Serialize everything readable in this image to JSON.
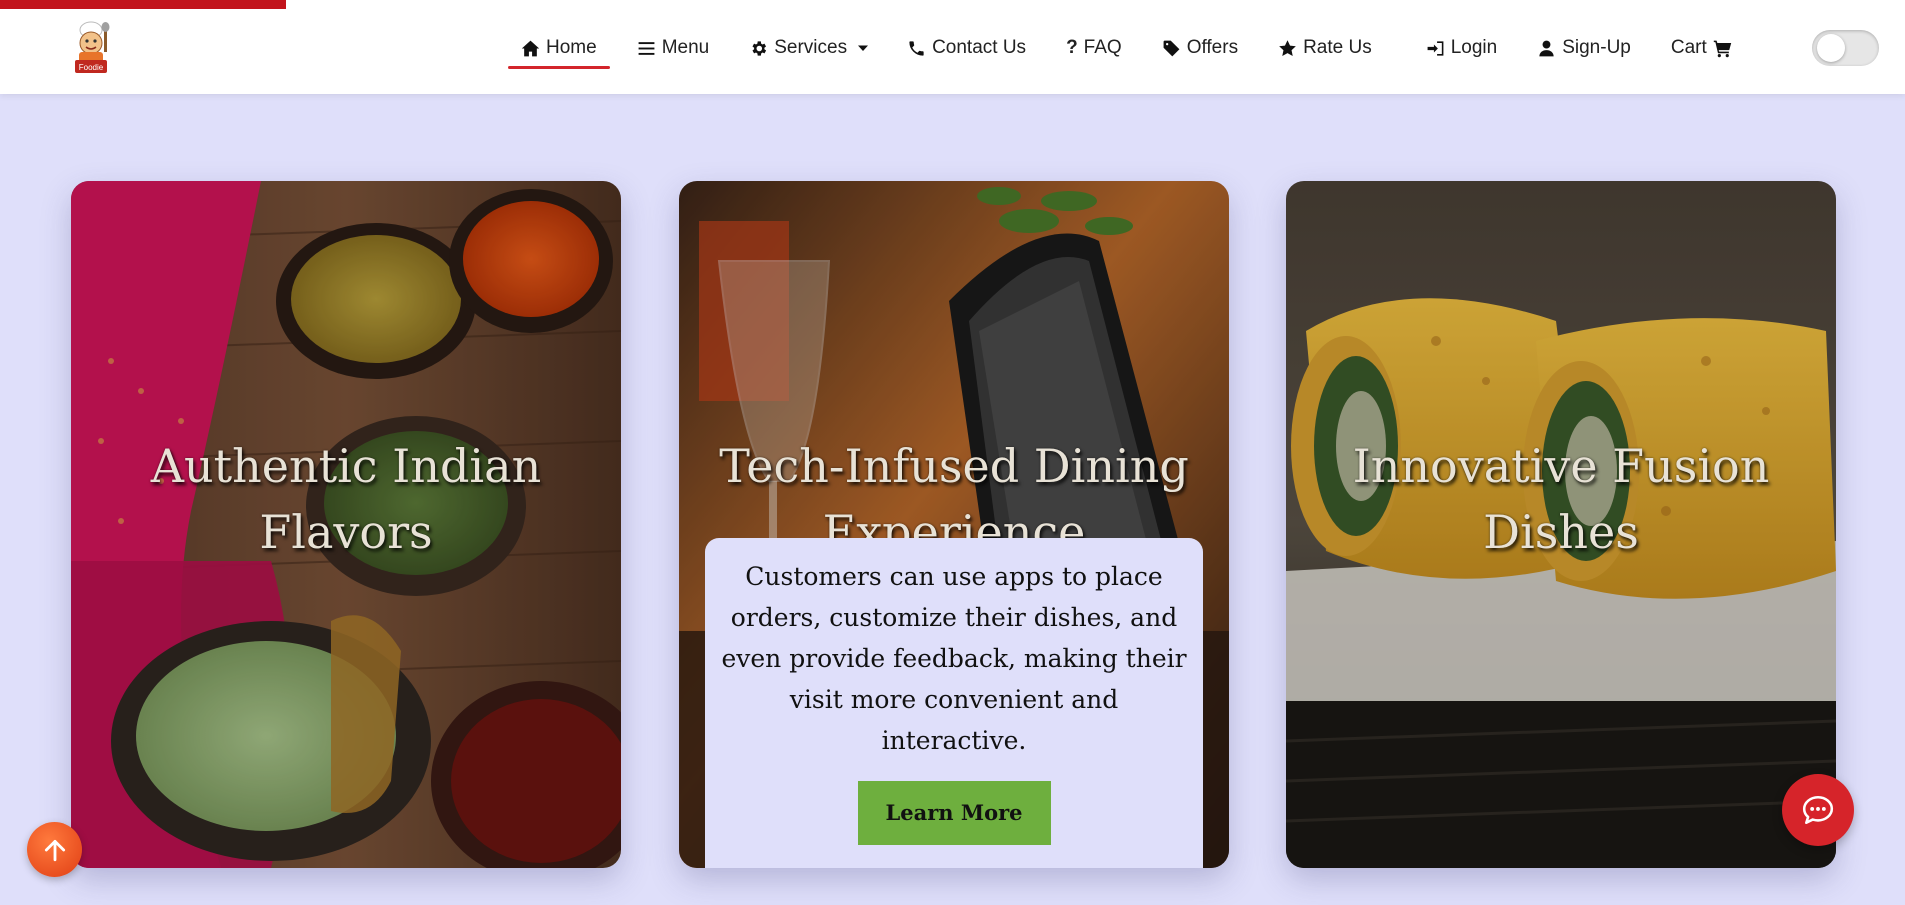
{
  "progress": {
    "fraction": 0.15
  },
  "logo": {
    "text": "Foodie"
  },
  "nav": {
    "home": "Home",
    "menu": "Menu",
    "services": "Services",
    "contact": "Contact Us",
    "faq": "FAQ",
    "offers": "Offers",
    "rate": "Rate Us",
    "login": "Login",
    "signup": "Sign-Up",
    "cart": "Cart"
  },
  "cards": [
    {
      "title": "Authentic Indian Flavors"
    },
    {
      "title": "Tech-Infused Dining Experience",
      "description": "Customers can use apps to place orders, customize their dishes, and even provide feedback, making their visit more convenient and interactive.",
      "button": "Learn More"
    },
    {
      "title": "Innovative Fusion Dishes"
    }
  ],
  "colors": {
    "background": "#dfdffa",
    "accent": "#d3252b",
    "button": "#6eaf3e",
    "chat": "#d6242a",
    "scroll_top": "#f05a22"
  },
  "icons": [
    "home-icon",
    "bars-icon",
    "gear-icon",
    "phone-icon",
    "question-icon",
    "tag-icon",
    "star-icon",
    "login-icon",
    "user-icon",
    "cart-icon",
    "arrow-up-icon",
    "chat-icon"
  ]
}
